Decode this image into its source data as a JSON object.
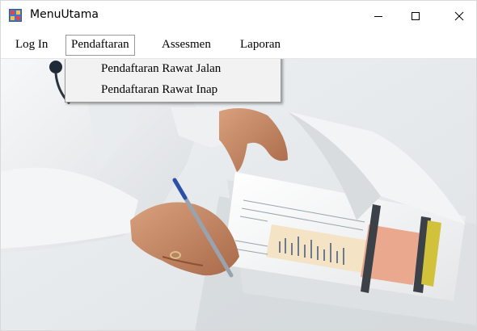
{
  "window": {
    "title": "MenuUtama"
  },
  "menubar": {
    "items": [
      {
        "label": "Log In"
      },
      {
        "label": "Pendaftaran"
      },
      {
        "label": "Assesmen"
      },
      {
        "label": "Laporan"
      }
    ]
  },
  "dropdown": {
    "items": [
      {
        "label": "Pendaftaran Rawat Jalan"
      },
      {
        "label": "Pendaftaran Rawat Inap"
      }
    ]
  },
  "icons": {
    "app": "app-form-icon",
    "minimize": "minimize-icon",
    "maximize": "maximize-icon",
    "close": "close-icon"
  }
}
